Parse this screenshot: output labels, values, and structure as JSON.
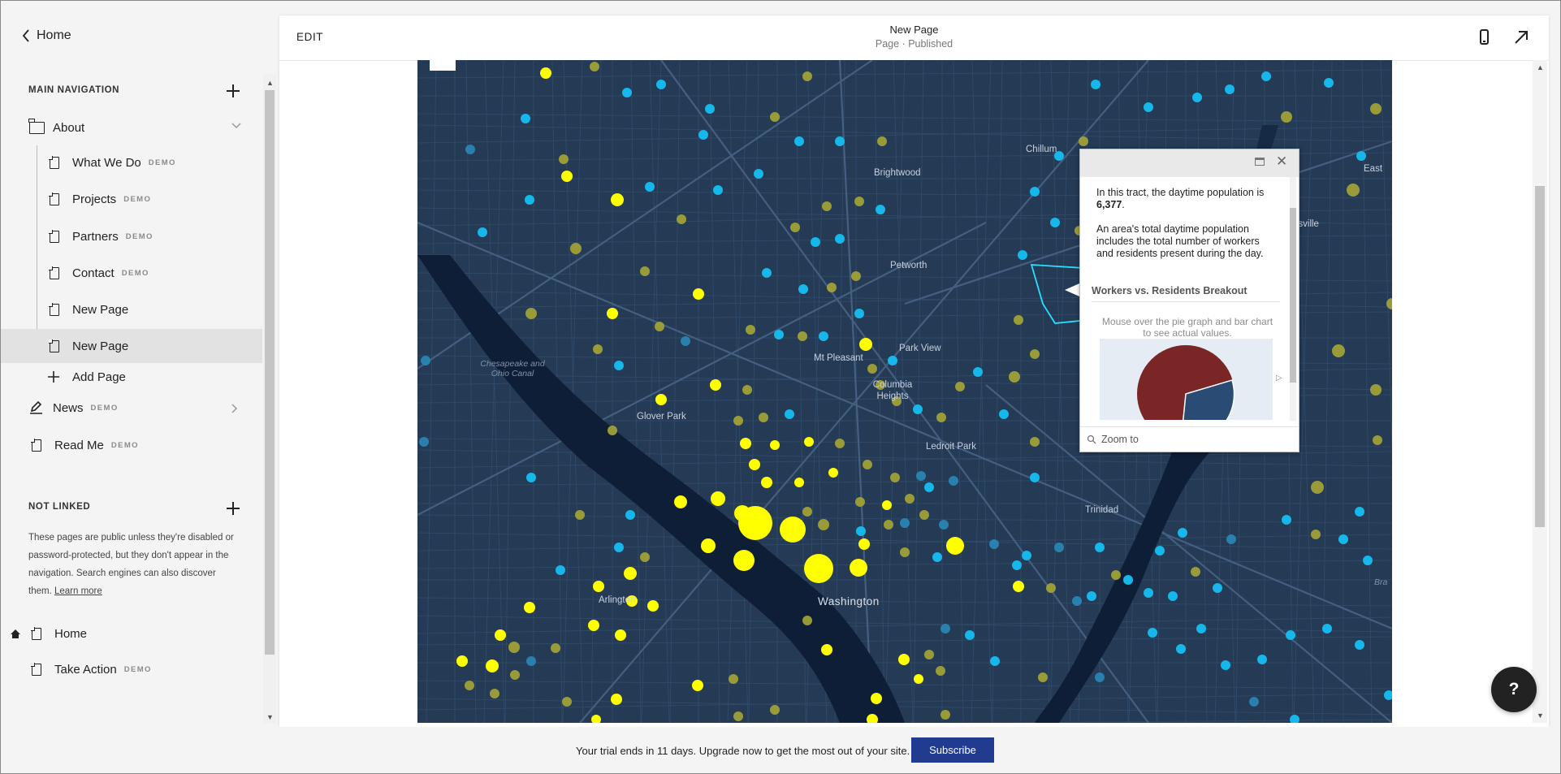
{
  "sidebar": {
    "back_label": "Home",
    "main_nav_title": "MAIN NAVIGATION",
    "items": [
      {
        "label": "About",
        "demo": "",
        "icon": "folder-icon"
      },
      {
        "label": "What We Do",
        "demo": "DEMO",
        "icon": "page-icon"
      },
      {
        "label": "Projects",
        "demo": "DEMO",
        "icon": "page-icon"
      },
      {
        "label": "Partners",
        "demo": "DEMO",
        "icon": "page-icon"
      },
      {
        "label": "Contact",
        "demo": "DEMO",
        "icon": "page-icon"
      },
      {
        "label": "New Page",
        "demo": "",
        "icon": "page-icon"
      },
      {
        "label": "New Page",
        "demo": "",
        "icon": "page-icon",
        "selected": true
      },
      {
        "label": "Add Page",
        "demo": "",
        "icon": "plus-icon"
      },
      {
        "label": "News",
        "demo": "DEMO",
        "icon": "blog-icon"
      },
      {
        "label": "Read Me",
        "demo": "DEMO",
        "icon": "page-icon"
      }
    ],
    "not_linked_title": "NOT LINKED",
    "not_linked_note": "These pages are public unless they're disabled or password-protected, but they don't appear in the navigation. Search engines can also discover them.",
    "learn_more": "Learn more",
    "not_linked_items": [
      {
        "label": "Home",
        "demo": "",
        "icon": "home-icon"
      },
      {
        "label": "Take Action",
        "demo": "DEMO",
        "icon": "page-icon"
      }
    ]
  },
  "header": {
    "edit_label": "EDIT",
    "page_title": "New Page",
    "page_status": "Page · Published"
  },
  "map": {
    "labels": {
      "chillum": "Chillum",
      "brightwood": "Brightwood",
      "petworth": "Petworth",
      "mt_pleasant": "Mt Pleasant",
      "park_view": "Park View",
      "columbia_heights": "Columbia Heights",
      "glover_park": "Glover Park",
      "ledroit_park": "Ledroit Park",
      "trinidad": "Trinidad",
      "arlington": "Arlington",
      "washington": "Washington",
      "canal": "Chesapeake and Ohio Canal",
      "east": "East",
      "ttsville": "ttsville",
      "bra": "Bra"
    },
    "colors": {
      "high": "#ffff00",
      "mid": "#a6a635",
      "low": "#16b7ea",
      "low_dim": "#2a88b7",
      "background": "#243a55"
    }
  },
  "popup": {
    "text_before": "In this tract, the daytime population is",
    "population": "6,377",
    "text_after": ".",
    "description": "An area's total daytime population includes the total number of workers and residents present during the day.",
    "subtitle": "Workers vs. Residents Breakout",
    "instruction": "Mouse over the pie graph and bar chart to see actual values.",
    "zoom_label": "Zoom to"
  },
  "footer": {
    "trial_text": "Your trial ends in 11 days. Upgrade now to get the most out of your site.",
    "subscribe_label": "Subscribe"
  },
  "help_label": "?"
}
